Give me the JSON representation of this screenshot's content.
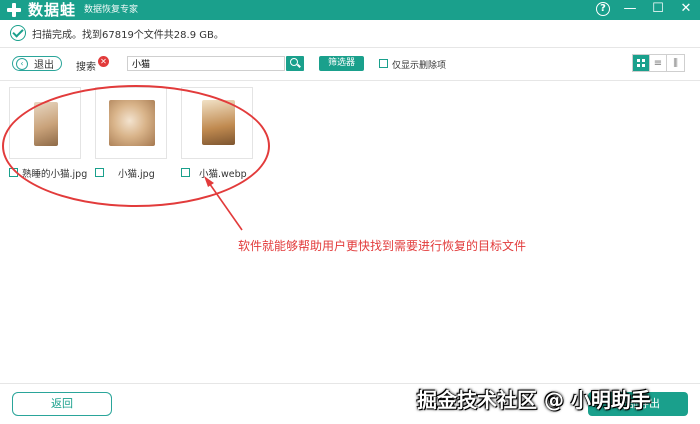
{
  "titlebar": {
    "app_name": "数据蛙",
    "app_subtitle": "数据恢复专家",
    "help": "?",
    "minimize": "—",
    "restore": "☐",
    "close": "✕",
    "background_color": "#1aa08c"
  },
  "status": {
    "text": "扫描完成。找到67819个文件共28.9 GB。"
  },
  "toolbar": {
    "back_label": "退出",
    "search_label": "搜索",
    "search_value": "小猫",
    "filter_label": "筛选器",
    "only_deleted_label": "仅显示删除项",
    "views": [
      "grid-icon",
      "list-icon",
      "detail-icon"
    ]
  },
  "files": [
    {
      "name": "熟睡的小猫.jpg",
      "thumb_color": "#c9a27a",
      "checked": false
    },
    {
      "name": "小猫.jpg",
      "thumb_color": "#d9b48a",
      "checked": false
    },
    {
      "name": "小猫.webp",
      "thumb_color": "#c08a50",
      "checked": false
    }
  ],
  "annotation": {
    "text": "软件就能够帮助用户更快找到需要进行恢复的目标文件",
    "color": "#e23b3b"
  },
  "footer": {
    "back_label": "返回",
    "recover_label": "全部导出"
  },
  "watermark": "掘金技术社区 @ 小明助手"
}
